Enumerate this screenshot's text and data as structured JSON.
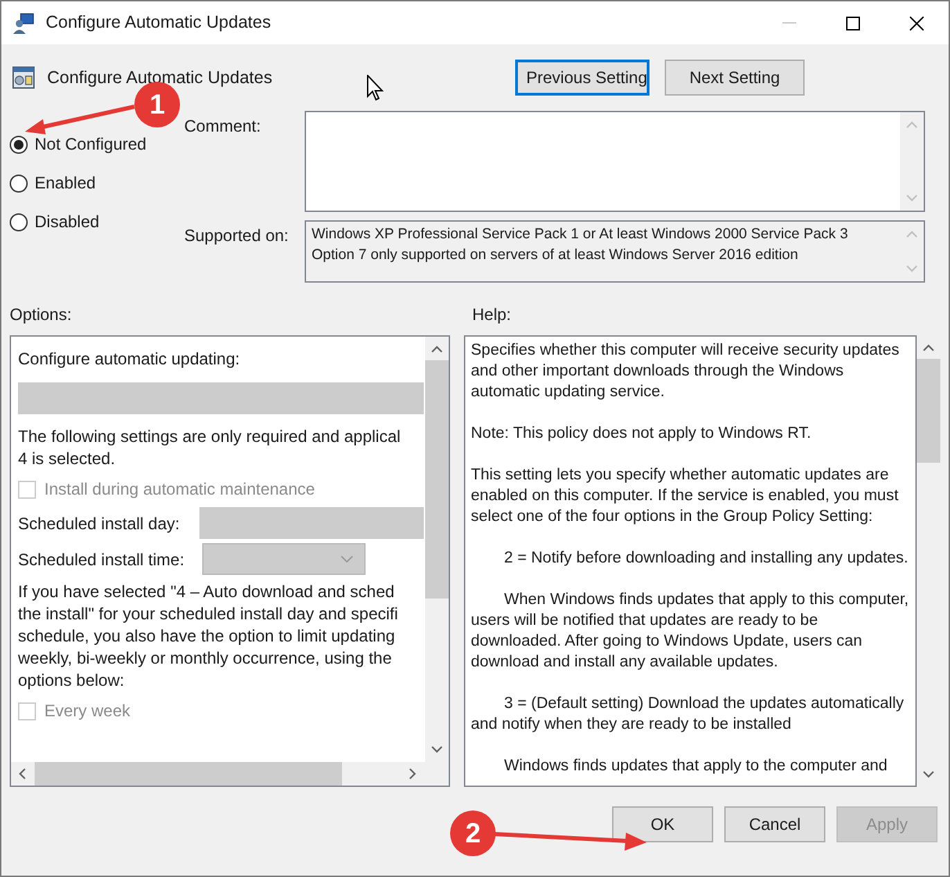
{
  "window": {
    "title": "Configure Automatic Updates"
  },
  "header": {
    "title": "Configure Automatic Updates"
  },
  "nav_buttons": [
    {
      "label": "Previous Setting",
      "focused": true
    },
    {
      "label": "Next Setting",
      "focused": false
    }
  ],
  "state_options": [
    {
      "label": "Not Configured",
      "selected": true
    },
    {
      "label": "Enabled",
      "selected": false
    },
    {
      "label": "Disabled",
      "selected": false
    }
  ],
  "comment": {
    "label": "Comment:"
  },
  "supported_on": {
    "label": "Supported on:",
    "lines": [
      "Windows XP Professional Service Pack 1 or At least Windows 2000 Service Pack 3",
      "Option 7 only supported on servers of at least Windows Server 2016 edition"
    ]
  },
  "options": {
    "label": "Options:",
    "items": [
      {
        "kind": "label",
        "text": "Configure automatic updating:"
      },
      {
        "kind": "dropdown"
      },
      {
        "kind": "text",
        "lines": [
          "The following settings are only required and applical",
          "4 is selected."
        ]
      },
      {
        "kind": "checkbox",
        "label": "Install during automatic maintenance",
        "checked": false
      },
      {
        "kind": "field",
        "label": "Scheduled install day:"
      },
      {
        "kind": "select",
        "label": "Scheduled install time:"
      },
      {
        "kind": "text",
        "lines": [
          "If you have selected \"4 – Auto download and sched",
          "the install\" for your scheduled install day and specifi",
          "schedule, you also have the option to limit updating",
          "weekly, bi-weekly or monthly occurrence, using the",
          "options below:"
        ]
      },
      {
        "kind": "checkbox",
        "label": "Every week",
        "checked": false
      }
    ]
  },
  "help": {
    "label": "Help:",
    "paragraphs": [
      {
        "kind": "plain",
        "text": "Specifies whether this computer will receive security updates and other important downloads through the Windows automatic updating service."
      },
      {
        "kind": "plain",
        "text": "Note: This policy does not apply to Windows RT."
      },
      {
        "kind": "plain",
        "text": "This setting lets you specify whether automatic updates are enabled on this computer. If the service is enabled, you must select one of the four options in the Group Policy Setting:"
      },
      {
        "kind": "indent",
        "text": "2 = Notify before downloading and installing any updates."
      },
      {
        "kind": "indent",
        "text": "When Windows finds updates that apply to this computer, users will be notified that updates are ready to be downloaded. After going to Windows Update, users can download and install any available updates."
      },
      {
        "kind": "indent",
        "text": "3 = (Default setting) Download the updates automatically and notify when they are ready to be installed"
      },
      {
        "kind": "indent",
        "text": "Windows finds updates that apply to the computer and"
      }
    ]
  },
  "buttons": [
    {
      "label": "OK",
      "disabled": false
    },
    {
      "label": "Cancel",
      "disabled": false
    },
    {
      "label": "Apply",
      "disabled": true
    }
  ],
  "annotations": [
    {
      "label": "1"
    },
    {
      "label": "2"
    }
  ]
}
